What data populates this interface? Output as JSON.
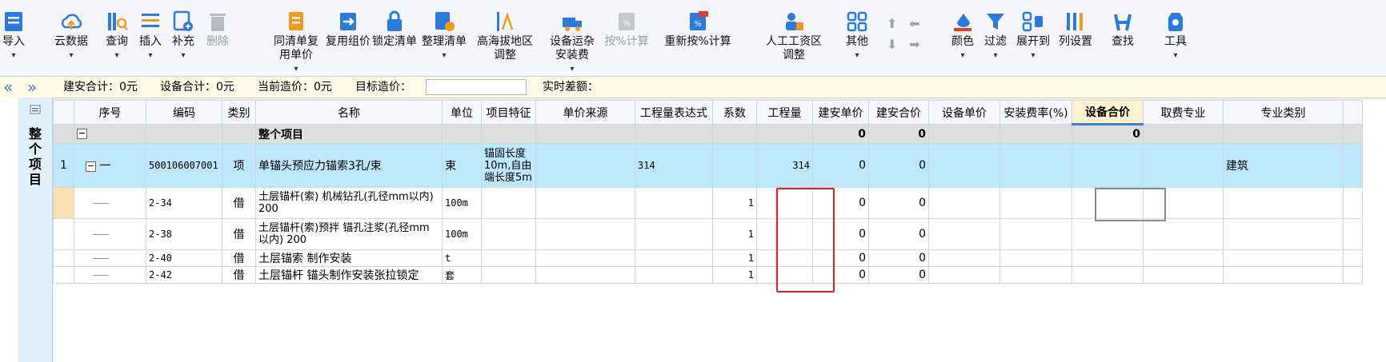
{
  "toolbar": {
    "items": [
      {
        "label": "导入",
        "label2": "",
        "icon": "import-icon",
        "dd": true
      },
      {
        "label": "云数据",
        "label2": "",
        "icon": "cloud-data-icon",
        "dd": true
      },
      {
        "label": "查询",
        "label2": "",
        "icon": "query-icon",
        "dd": true
      },
      {
        "label": "插入",
        "label2": "",
        "icon": "insert-icon",
        "dd": true
      },
      {
        "label": "补充",
        "label2": "",
        "icon": "supplement-icon",
        "dd": true
      },
      {
        "label": "删除",
        "label2": "",
        "icon": "delete-icon",
        "dd": false,
        "disabled": true
      },
      {
        "label": "同清单复",
        "label2": "用单价",
        "icon": "copy-price-icon",
        "dd": true
      },
      {
        "label": "复用组价",
        "label2": "",
        "icon": "reuse-pricing-icon",
        "dd": false
      },
      {
        "label": "锁定清单",
        "label2": "",
        "icon": "lock-list-icon",
        "dd": false
      },
      {
        "label": "整理清单",
        "label2": "",
        "icon": "organize-list-icon",
        "dd": true
      },
      {
        "label": "高海拔地区",
        "label2": "调整",
        "icon": "altitude-icon",
        "dd": false
      },
      {
        "label": "设备运杂",
        "label2": "安装费",
        "icon": "equipment-fee-icon",
        "dd": true
      },
      {
        "label": "按%计算",
        "label2": "",
        "icon": "percent-calc-icon",
        "dd": false,
        "disabled": true
      },
      {
        "label": "重新按%计算",
        "label2": "",
        "icon": "recalc-percent-icon",
        "dd": false
      },
      {
        "label": "人工工资区",
        "label2": "调整",
        "icon": "labor-wage-icon",
        "dd": false
      },
      {
        "label": "其他",
        "label2": "",
        "icon": "other-icon",
        "dd": true
      },
      {
        "label": "颜色",
        "label2": "",
        "icon": "color-icon",
        "dd": true
      },
      {
        "label": "过滤",
        "label2": "",
        "icon": "filter-icon",
        "dd": true
      },
      {
        "label": "展开到",
        "label2": "",
        "icon": "expand-to-icon",
        "dd": true
      },
      {
        "label": "列设置",
        "label2": "",
        "icon": "column-settings-icon",
        "dd": false
      },
      {
        "label": "查找",
        "label2": "",
        "icon": "find-icon",
        "dd": false
      },
      {
        "label": "工具",
        "label2": "",
        "icon": "tools-icon",
        "dd": true
      }
    ]
  },
  "summary": {
    "jianan_total": "建安合计：0元",
    "equipment_total": "设备合计：0元",
    "current_cost": "当前造价：0元",
    "target_cost_label": "目标造价：",
    "target_cost_value": "",
    "realtime_diff": "实时差额："
  },
  "side": {
    "title": "整个项目"
  },
  "table": {
    "columns": [
      "",
      "序号",
      "编码",
      "类别",
      "名称",
      "单位",
      "项目特征",
      "单价来源",
      "工程量表达式",
      "系数",
      "工程量",
      "建安单价",
      "建安合价",
      "设备单价",
      "安装费率(%)",
      "设备合价",
      "取费专业",
      "专业类别",
      ""
    ],
    "total_row": {
      "name": "整个项目",
      "jianan_price": "0",
      "jianan_total": "0",
      "equip_total": "0"
    },
    "item_row": {
      "rownum": "1",
      "seq": "一",
      "code": "500106007001",
      "type": "项",
      "name": "单锚头预应力锚索3孔/束",
      "unit": "束",
      "feature": "锚固长度10m,自由端长度5m",
      "expr": "314",
      "qty": "314",
      "jianan_price": "0",
      "jianan_total": "0",
      "category": "建筑"
    },
    "sub_rows": [
      {
        "code": "2-34",
        "type": "借",
        "name": "土层锚杆(索) 机械钻孔(孔径mm以内) 200",
        "unit": "100m",
        "coef": "1",
        "qty": "",
        "price": "0",
        "total": "0"
      },
      {
        "code": "2-38",
        "type": "借",
        "name": "土层锚杆(索)预拌 锚孔注浆(孔径mm以内) 200",
        "unit": "100m",
        "coef": "1",
        "qty": "",
        "price": "0",
        "total": "0"
      },
      {
        "code": "2-40",
        "type": "借",
        "name": "土层锚索 制作安装",
        "unit": "t",
        "coef": "1",
        "qty": "",
        "price": "0",
        "total": "0"
      },
      {
        "code": "2-42",
        "type": "借",
        "name": "土层锚杆 锚头制作安装张拉锁定",
        "unit": "套",
        "coef": "1",
        "qty": "",
        "price": "0",
        "total": "0"
      }
    ]
  },
  "colors": {
    "accent": "#2a7be0",
    "item_row_bg": "#bde8fa",
    "highlight_box": "#e02020",
    "summary_bg": "#fffbe6"
  }
}
